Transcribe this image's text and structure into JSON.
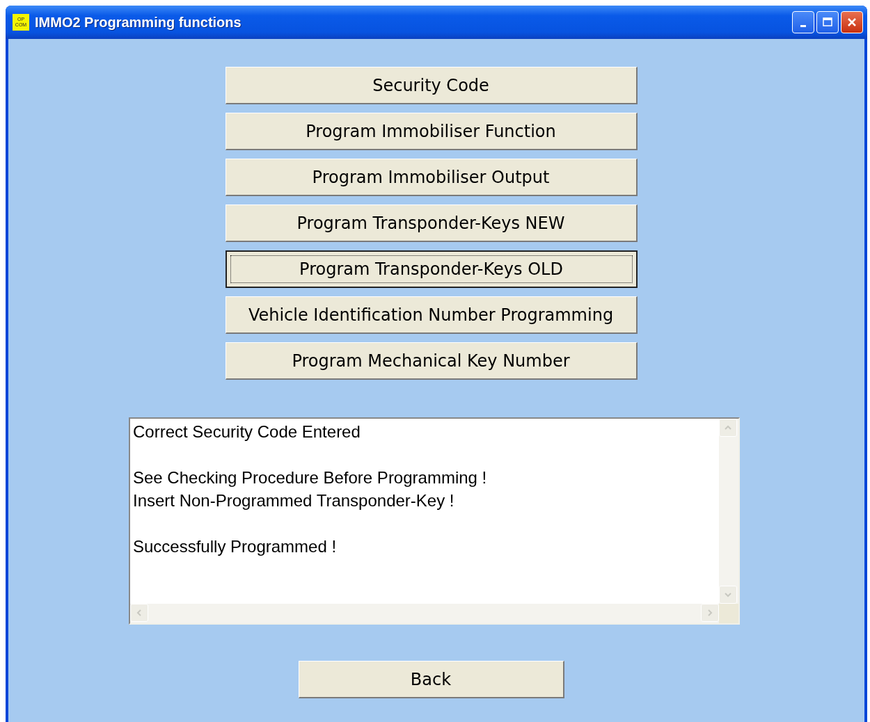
{
  "window": {
    "title": "IMMO2 Programming functions",
    "app_icon_lines": [
      "OP",
      "COM"
    ]
  },
  "functions": [
    {
      "label": "Security Code",
      "focused": false
    },
    {
      "label": "Program Immobiliser Function",
      "focused": false
    },
    {
      "label": "Program Immobiliser Output",
      "focused": false
    },
    {
      "label": "Program Transponder-Keys NEW",
      "focused": false
    },
    {
      "label": "Program Transponder-Keys OLD",
      "focused": true
    },
    {
      "label": "Vehicle Identification Number Programming",
      "focused": false
    },
    {
      "label": "Program Mechanical Key Number",
      "focused": false
    }
  ],
  "log": {
    "paragraphs": [
      [
        "Correct Security Code Entered"
      ],
      [
        "See Checking Procedure Before Programming !",
        "Insert Non-Programmed Transponder-Key !"
      ],
      [
        "Successfully Programmed !"
      ]
    ]
  },
  "back_button": "Back"
}
